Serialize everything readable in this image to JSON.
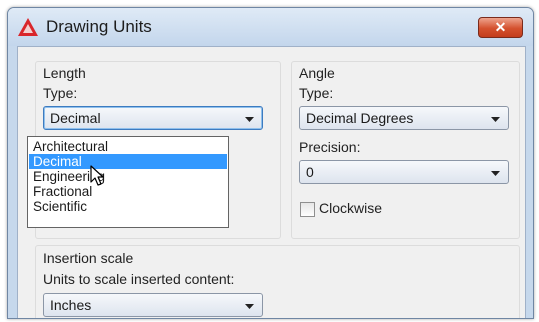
{
  "window": {
    "title": "Drawing Units",
    "close_label": "✕",
    "icon": "autocad-app-icon"
  },
  "length": {
    "group_label": "Length",
    "type_label": "Type:",
    "type_value": "Decimal",
    "options": [
      "Architectural",
      "Decimal",
      "Engineering",
      "Fractional",
      "Scientific"
    ],
    "highlighted_option": "Decimal"
  },
  "angle": {
    "group_label": "Angle",
    "type_label": "Type:",
    "type_value": "Decimal Degrees",
    "precision_label": "Precision:",
    "precision_value": "0",
    "clockwise_label": "Clockwise",
    "clockwise_checked": false
  },
  "insertion": {
    "group_label": "Insertion scale",
    "units_label": "Units to scale inserted content:",
    "units_value": "Inches"
  },
  "colors": {
    "accent": "#3399ff",
    "title_bar": "#c6d8ec",
    "close_button": "#d4512e"
  }
}
